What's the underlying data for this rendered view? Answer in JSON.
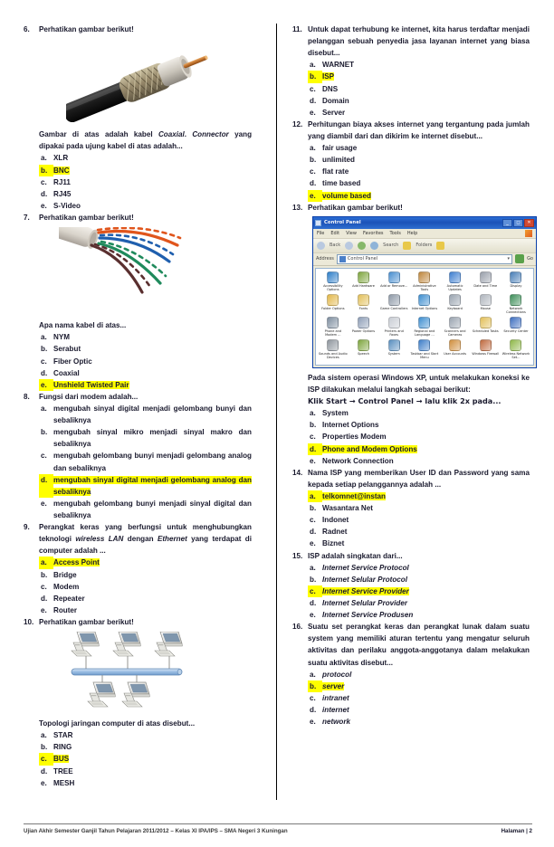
{
  "footer": {
    "left": "Ujian Akhir Semester Ganjil Tahun Pelajaran 2011/2012 – Kelas XI IPA/IPS – SMA Negeri 3 Kuningan",
    "right": "Halaman | 2"
  },
  "highlight_color": "#ffff00",
  "questions": [
    {
      "number": "6.",
      "stem_parts": [
        {
          "text": "Perhatikan gambar berikut!",
          "style": "bold"
        }
      ],
      "figure": "coaxial-cable-photo",
      "stem_after_parts": [
        {
          "text": "Gambar di atas adalah kabel ",
          "style": "bold"
        },
        {
          "text": "Coaxial",
          "style": "bold-italic"
        },
        {
          "text": ". ",
          "style": "bold"
        },
        {
          "text": "Connector",
          "style": "italic"
        },
        {
          "text": " yang dipakai pada ujung kabel di atas adalah...",
          "style": "bold"
        }
      ],
      "options": [
        {
          "letter": "a.",
          "text": "XLR",
          "highlight": false
        },
        {
          "letter": "b.",
          "text": "BNC",
          "highlight": true
        },
        {
          "letter": "c.",
          "text": "RJ11",
          "highlight": false
        },
        {
          "letter": "d.",
          "text": "RJ45",
          "highlight": false
        },
        {
          "letter": "e.",
          "text": "S-Video",
          "highlight": false
        }
      ]
    },
    {
      "number": "7.",
      "stem_parts": [
        {
          "text": "Perhatikan gambar berikut!",
          "style": "bold"
        }
      ],
      "figure": "utp-cable-photo",
      "stem_after_parts": [
        {
          "text": "Apa nama kabel di atas...",
          "style": "bold"
        }
      ],
      "options": [
        {
          "letter": "a.",
          "text": "NYM",
          "highlight": false
        },
        {
          "letter": "b.",
          "text": "Serabut",
          "highlight": false
        },
        {
          "letter": "c.",
          "text": "Fiber Optic",
          "highlight": false
        },
        {
          "letter": "d.",
          "text": "Coaxial",
          "highlight": false
        },
        {
          "letter": "e.",
          "text": "Unshield Twisted Pair",
          "highlight": true
        }
      ]
    },
    {
      "number": "8.",
      "stem_parts": [
        {
          "text": "Fungsi dari modem adalah...",
          "style": "bold"
        }
      ],
      "options": [
        {
          "letter": "a.",
          "text": "mengubah sinyal digital menjadi gelombang bunyi dan sebaliknya",
          "highlight": false,
          "justify": true
        },
        {
          "letter": "b.",
          "text": "mengubah sinyal mikro menjadi sinyal makro dan sebaliknya",
          "highlight": false,
          "justify": true
        },
        {
          "letter": "c.",
          "text": "mengubah gelombang bunyi menjadi gelombang analog dan sebaliknya",
          "highlight": false,
          "justify": true
        },
        {
          "letter": "d.",
          "text": "mengubah sinyal digital menjadi gelombang analog dan sebaliknya",
          "highlight": true,
          "justify": true
        },
        {
          "letter": "e.",
          "text": "mengubah gelombang bunyi menjadi sinyal digital dan sebaliknya",
          "highlight": false,
          "justify": true
        }
      ]
    },
    {
      "number": "9.",
      "stem_parts": [
        {
          "text": "Perangkat keras yang berfungsi untuk menghubungkan teknologi ",
          "style": "bold"
        },
        {
          "text": "wireless LAN",
          "style": "bold-italic"
        },
        {
          "text": " dengan ",
          "style": "bold"
        },
        {
          "text": "Ethernet",
          "style": "bold-italic"
        },
        {
          "text": " yang terdapat di computer adalah ...",
          "style": "bold"
        }
      ],
      "justify_stem": true,
      "options": [
        {
          "letter": "a.",
          "text": "Access Point",
          "highlight": true
        },
        {
          "letter": "b.",
          "text": "Bridge",
          "highlight": false
        },
        {
          "letter": "c.",
          "text": "Modem",
          "highlight": false
        },
        {
          "letter": "d.",
          "text": "Repeater",
          "highlight": false
        },
        {
          "letter": "e.",
          "text": "Router",
          "highlight": false
        }
      ]
    },
    {
      "number": "10.",
      "stem_parts": [
        {
          "text": "Perhatikan gambar berikut!",
          "style": "bold"
        }
      ],
      "figure": "bus-topology-diagram",
      "stem_after_parts": [
        {
          "text": "Topologi jaringan computer di atas disebut...",
          "style": "bold"
        }
      ],
      "options": [
        {
          "letter": "a.",
          "text": "STAR",
          "highlight": false
        },
        {
          "letter": "b.",
          "text": "RING",
          "highlight": false
        },
        {
          "letter": "c.",
          "text": "BUS",
          "highlight": true
        },
        {
          "letter": "d.",
          "text": "TREE",
          "highlight": false
        },
        {
          "letter": "e.",
          "text": "MESH",
          "highlight": false
        }
      ]
    },
    {
      "number": "11.",
      "stem_parts": [
        {
          "text": "Untuk dapat terhubung ke internet, kita harus terdaftar menjadi pelanggan sebuah penyedia jasa layanan internet yang biasa disebut...",
          "style": "bold"
        }
      ],
      "justify_stem": true,
      "options": [
        {
          "letter": "a.",
          "text": "WARNET",
          "highlight": false
        },
        {
          "letter": "b.",
          "text": "ISP",
          "highlight": true
        },
        {
          "letter": "c.",
          "text": "DNS",
          "highlight": false
        },
        {
          "letter": "d.",
          "text": "Domain",
          "highlight": false
        },
        {
          "letter": "e.",
          "text": "Server",
          "highlight": false
        }
      ]
    },
    {
      "number": "12.",
      "stem_parts": [
        {
          "text": "Perhitungan biaya akses internet yang tergantung pada jumlah yang diambil dari dan dikirim ke internet disebut...",
          "style": "bold"
        }
      ],
      "justify_stem": true,
      "options": [
        {
          "letter": "a.",
          "text": "fair usage",
          "highlight": false
        },
        {
          "letter": "b.",
          "text": "unlimited",
          "highlight": false
        },
        {
          "letter": "c.",
          "text": "flat rate",
          "highlight": false
        },
        {
          "letter": "d.",
          "text": "time based",
          "highlight": false
        },
        {
          "letter": "e.",
          "text": "volume based",
          "highlight": true
        }
      ]
    },
    {
      "number": "13.",
      "stem_parts": [
        {
          "text": "Perhatikan gambar berikut!",
          "style": "bold"
        }
      ],
      "figure": "control-panel-screenshot",
      "stem_after_parts": [
        {
          "text": "Pada sistem operasi Windows XP, untuk melakukan koneksi ke ISP dilakukan melalui langkah sebagai berikut:",
          "style": "bold"
        }
      ],
      "stem_line2": "Klik Start → Control Panel → lalu klik 2x pada...",
      "options": [
        {
          "letter": "a.",
          "text": "System",
          "highlight": false
        },
        {
          "letter": "b.",
          "text": "Internet Options",
          "highlight": false
        },
        {
          "letter": "c.",
          "text": "Properties Modem",
          "highlight": false
        },
        {
          "letter": "d.",
          "text": "Phone and Modem Options",
          "highlight": true
        },
        {
          "letter": "e.",
          "text": "Network Connection",
          "highlight": false
        }
      ]
    },
    {
      "number": "14.",
      "stem_parts": [
        {
          "text": "Nama ISP yang memberikan User ID dan Password yang sama kepada setiap pelanggannya adalah ...",
          "style": "bold"
        }
      ],
      "justify_stem": true,
      "options": [
        {
          "letter": "a.",
          "text": "telkomnet@instan",
          "highlight": true
        },
        {
          "letter": "b.",
          "text": "Wasantara Net",
          "highlight": false
        },
        {
          "letter": "c.",
          "text": "Indonet",
          "highlight": false
        },
        {
          "letter": "d.",
          "text": "Radnet",
          "highlight": false
        },
        {
          "letter": "e.",
          "text": "Biznet",
          "highlight": false
        }
      ]
    },
    {
      "number": "15.",
      "stem_parts": [
        {
          "text": "ISP adalah singkatan dari...",
          "style": "bold"
        }
      ],
      "options": [
        {
          "letter": "a.",
          "text": "Internet Service Protocol",
          "highlight": false,
          "italic": true
        },
        {
          "letter": "b.",
          "text": "Internet Selular Protocol",
          "highlight": false,
          "italic": true
        },
        {
          "letter": "c.",
          "text": "Internet Service Provider",
          "highlight": true,
          "italic": true
        },
        {
          "letter": "d.",
          "text": "Internet Selular Provider",
          "highlight": false,
          "italic": true
        },
        {
          "letter": "e.",
          "text": "Internet Service Produsen",
          "highlight": false,
          "italic": true
        }
      ]
    },
    {
      "number": "16.",
      "stem_parts": [
        {
          "text": "Suatu set perangkat keras dan perangkat lunak dalam suatu system yang memiliki aturan tertentu yang mengatur seluruh aktivitas dan perilaku anggota-anggotanya dalam melakukan suatu aktivitas disebut...",
          "style": "bold"
        }
      ],
      "justify_stem": true,
      "options": [
        {
          "letter": "a.",
          "text": "protocol",
          "highlight": false,
          "italic": true
        },
        {
          "letter": "b.",
          "text": "server",
          "highlight": true,
          "italic": true
        },
        {
          "letter": "c.",
          "text": "intranet",
          "highlight": false,
          "italic": true
        },
        {
          "letter": "d.",
          "text": "internet",
          "highlight": false,
          "italic": true
        },
        {
          "letter": "e.",
          "text": "network",
          "highlight": false,
          "italic": true
        }
      ]
    }
  ],
  "control_panel": {
    "window_title": "Control Panel",
    "menu": [
      "File",
      "Edit",
      "View",
      "Favorites",
      "Tools",
      "Help"
    ],
    "toolbar": [
      "Back",
      "Search",
      "Folders"
    ],
    "address_label": "Address",
    "address_value": "Control Panel",
    "go_label": "Go",
    "items": [
      {
        "label": "Accessibility Options",
        "color": "#2f7fc9"
      },
      {
        "label": "Add Hardware",
        "color": "#7fa63f"
      },
      {
        "label": "Add or Remove...",
        "color": "#4a8fd0"
      },
      {
        "label": "Administrative Tools",
        "color": "#c0883f"
      },
      {
        "label": "Automatic Updates",
        "color": "#3f7fd0"
      },
      {
        "label": "Date and Time",
        "color": "#9aa0ab"
      },
      {
        "label": "Display",
        "color": "#4a7fb8"
      },
      {
        "label": "Folder Options",
        "color": "#e2b84a"
      },
      {
        "label": "Fonts",
        "color": "#e2c05a"
      },
      {
        "label": "Game Controllers",
        "color": "#8f9aa8"
      },
      {
        "label": "Internet Options",
        "color": "#3f8fd0"
      },
      {
        "label": "Keyboard",
        "color": "#9aa4b0"
      },
      {
        "label": "Mouse",
        "color": "#b0b6be"
      },
      {
        "label": "Network Connections",
        "color": "#3f8f5a"
      },
      {
        "label": "Phone and Modem ...",
        "color": "#7f8fa0"
      },
      {
        "label": "Power Options",
        "color": "#8f9fb8"
      },
      {
        "label": "Printers and Faxes",
        "color": "#c9cdd4"
      },
      {
        "label": "Regional and Language ...",
        "color": "#3f8fd0"
      },
      {
        "label": "Scanners and Cameras",
        "color": "#9aa4b0"
      },
      {
        "label": "Scheduled Tasks",
        "color": "#e2c05a"
      },
      {
        "label": "Security Center",
        "color": "#3f6fc0"
      },
      {
        "label": "Sounds and Audio Devices",
        "color": "#8f969e"
      },
      {
        "label": "Speech",
        "color": "#7fa63f"
      },
      {
        "label": "System",
        "color": "#5a8fc0"
      },
      {
        "label": "Taskbar and Start Menu",
        "color": "#3f7fc9"
      },
      {
        "label": "User Accounts",
        "color": "#d08f3f"
      },
      {
        "label": "Windows Firewall",
        "color": "#c06a3f"
      },
      {
        "label": "Wireless Network Set...",
        "color": "#8fb84a"
      }
    ]
  }
}
